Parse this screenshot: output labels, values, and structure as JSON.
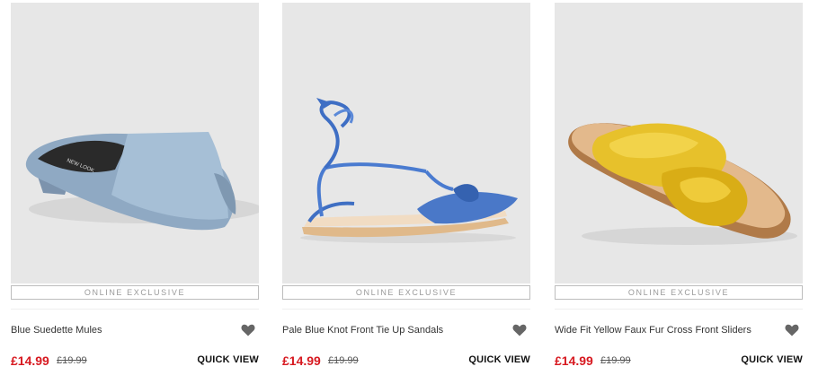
{
  "products": [
    {
      "name": "Blue Suedette Mules",
      "badge": "ONLINE EXCLUSIVE",
      "price": "£14.99",
      "was_price": "£19.99",
      "quick_view": "QUICK VIEW",
      "image_icon": "blue-mule-image",
      "insole_text": "NEW LOOK"
    },
    {
      "name": "Pale Blue Knot Front Tie Up Sandals",
      "badge": "ONLINE EXCLUSIVE",
      "price": "£14.99",
      "was_price": "£19.99",
      "quick_view": "QUICK VIEW",
      "image_icon": "blue-tie-up-sandal-image"
    },
    {
      "name": "Wide Fit Yellow Faux Fur Cross Front Sliders",
      "badge": "ONLINE EXCLUSIVE",
      "price": "£14.99",
      "was_price": "£19.99",
      "quick_view": "QUICK VIEW",
      "image_icon": "yellow-fur-slider-image"
    }
  ],
  "colors": {
    "price": "#d71920",
    "image_bg": "#e7e7e7",
    "badge_border": "#bdbdbd"
  },
  "icons": {
    "wishlist": "heart-icon"
  }
}
